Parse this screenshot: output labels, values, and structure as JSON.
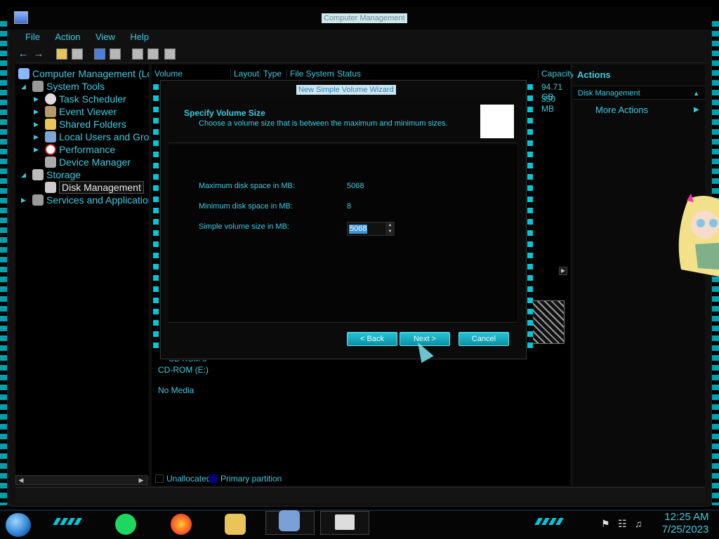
{
  "window": {
    "title": "Computer Management"
  },
  "menu": [
    "File",
    "Action",
    "View",
    "Help"
  ],
  "tree": [
    {
      "label": "Computer Management (Loc"
    },
    {
      "label": "System Tools"
    },
    {
      "label": "Task Scheduler"
    },
    {
      "label": "Event Viewer"
    },
    {
      "label": "Shared Folders"
    },
    {
      "label": "Local Users and Grou"
    },
    {
      "label": "Performance"
    },
    {
      "label": "Device Manager"
    },
    {
      "label": "Storage"
    },
    {
      "label": "Disk Management"
    },
    {
      "label": "Services and Applications"
    }
  ],
  "columns": [
    "Volume",
    "Layout",
    "Type",
    "File System",
    "Status",
    "Capacity"
  ],
  "capacities": [
    "94.71 GB",
    "350 MB"
  ],
  "disks": {
    "cdrom_name": "CD-ROM 0",
    "cdrom_drive": "CD-ROM (E:)",
    "media": "No Media"
  },
  "legend": [
    {
      "label": "Unallocated",
      "color": "#000000"
    },
    {
      "label": "Primary partition",
      "color": "#000080"
    }
  ],
  "actions": {
    "heading": "Actions",
    "section": "Disk Management",
    "more": "More Actions"
  },
  "wizard": {
    "title": "New Simple Volume Wizard",
    "heading": "Specify Volume Size",
    "subheading": "Choose a volume size that is between the maximum and minimum sizes.",
    "max_label": "Maximum disk space in MB:",
    "max_value": "5068",
    "min_label": "Minimum disk space in MB:",
    "min_value": "8",
    "size_label": "Simple volume size in MB:",
    "size_value": "5068",
    "back": "< Back",
    "next": "Next >",
    "cancel": "Cancel"
  },
  "taskbar": {
    "time": "12:25 AM",
    "date": "7/25/2023"
  },
  "colors": {
    "accent": "#3ecbe0",
    "button": "#16b0c2"
  },
  "icons": [
    "start-orb-icon",
    "spotify-icon",
    "firefox-icon",
    "file-explorer-icon",
    "computer-management-icon",
    "mail-icon",
    "flag-icon",
    "network-icon",
    "volume-icon"
  ]
}
